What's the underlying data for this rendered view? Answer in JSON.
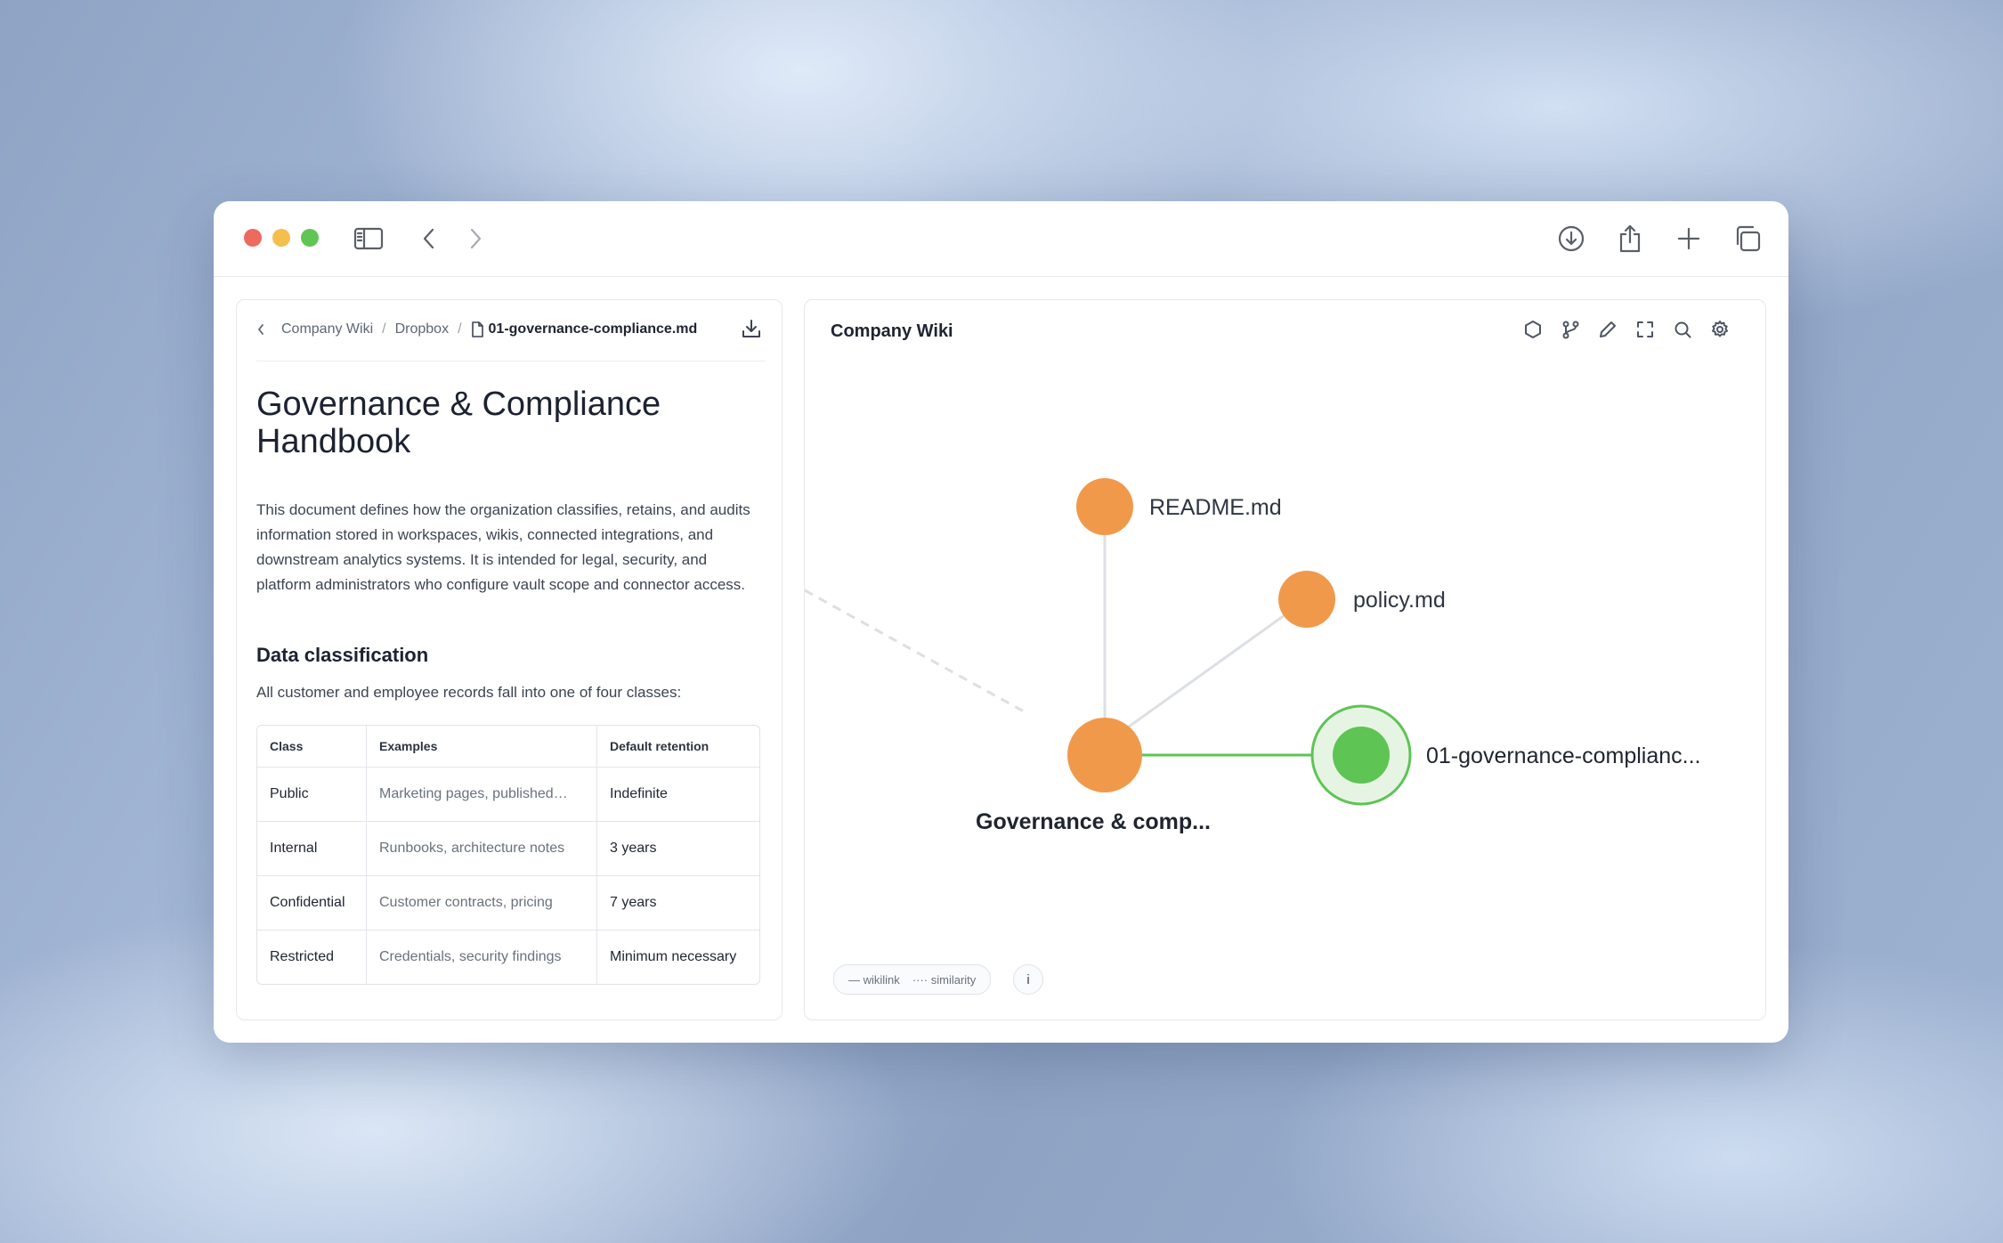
{
  "breadcrumb": {
    "root": "Company Wiki",
    "folder": "Dropbox",
    "file": "01-governance-compliance.md",
    "sep": "/"
  },
  "document": {
    "title": "Governance & Compliance Handbook",
    "intro": "This document defines how the organization classifies, retains, and audits information stored in workspaces, wikis, connected integrations, and downstream analytics systems. It is intended for legal, security, and platform administrators who configure vault scope and connector access.",
    "section_heading": "Data classification",
    "section_text": "All customer and employee records fall into one of four classes:",
    "table": {
      "headers": [
        "Class",
        "Examples",
        "Default retention"
      ],
      "rows": [
        [
          "Public",
          "Marketing pages, published…",
          "Indefinite"
        ],
        [
          "Internal",
          "Runbooks, architecture notes",
          "3 years"
        ],
        [
          "Confidential",
          "Customer contracts, pricing",
          "7 years"
        ],
        [
          "Restricted",
          "Credentials, security findings",
          "Minimum necessary"
        ]
      ]
    }
  },
  "graph": {
    "title": "Company Wiki",
    "nodes": {
      "readme": "README.md",
      "policy": "policy.md",
      "governance": "Governance & comp...",
      "current": "01-governance-complianc..."
    },
    "legend": {
      "wikilink": "— wikilink",
      "similarity": "···· similarity"
    },
    "info": "i",
    "colors": {
      "node": "#f0994a",
      "active": "#5ec454",
      "active_ring": "#e6f5e3",
      "edge": "#dcdfe4",
      "active_edge": "#5ec454"
    }
  },
  "icons": {
    "toolbar": [
      "sidebar-icon",
      "back-icon",
      "forward-icon",
      "download-icon",
      "share-icon",
      "plus-icon",
      "tabs-icon"
    ],
    "graph_tools": [
      "hexagon-icon",
      "branch-icon",
      "pencil-icon",
      "expand-icon",
      "search-icon",
      "gear-icon"
    ]
  }
}
